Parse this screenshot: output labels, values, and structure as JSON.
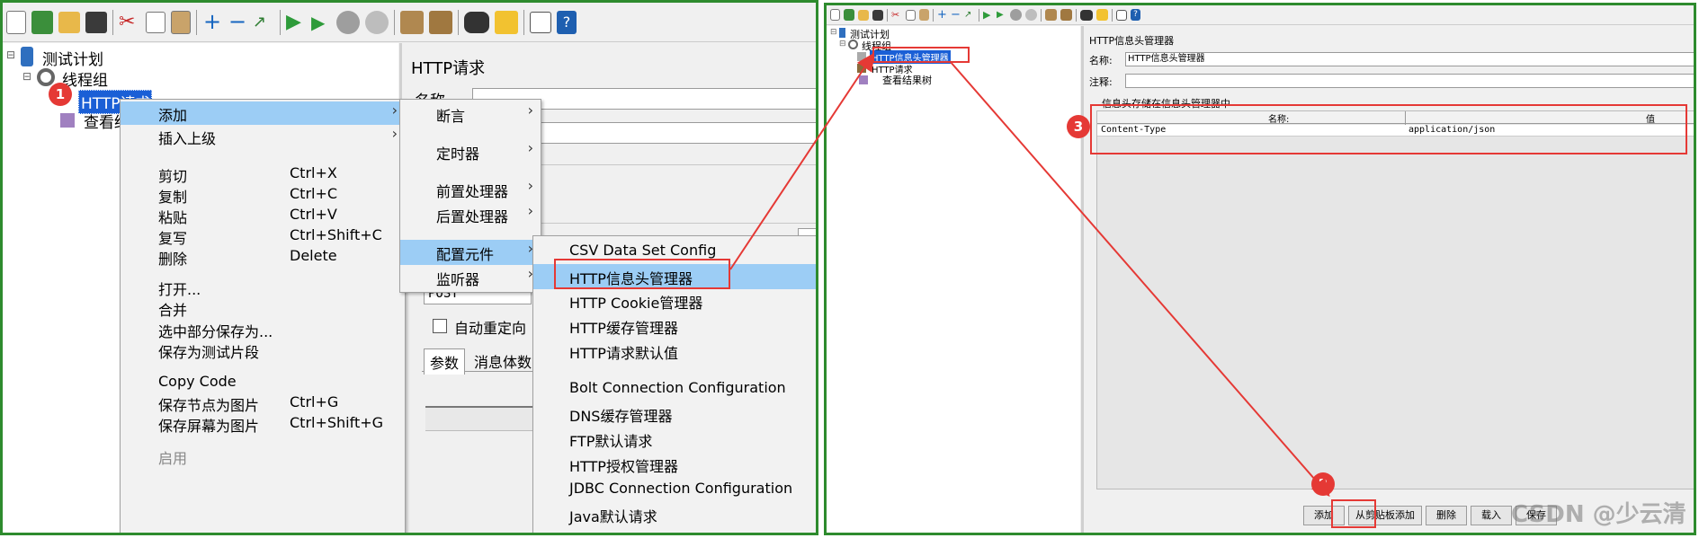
{
  "left": {
    "tree": {
      "test_plan": "测试计划",
      "thread_group": "线程组",
      "http_request": "HTTP请求",
      "view_results": "查看结"
    },
    "right_form": {
      "title": "HTTP请求",
      "name_label": "名称",
      "method_value": "POST",
      "auto_redirect": "自动重定向",
      "tab_params": "参数",
      "tab_body": "消息体数"
    },
    "context_menu": [
      {
        "label": "添加",
        "shortcut": "",
        "submenu": true
      },
      {
        "label": "插入上级",
        "shortcut": "",
        "submenu": true
      },
      {
        "label": "剪切",
        "shortcut": "Ctrl+X"
      },
      {
        "label": "复制",
        "shortcut": "Ctrl+C"
      },
      {
        "label": "粘贴",
        "shortcut": "Ctrl+V"
      },
      {
        "label": "复写",
        "shortcut": "Ctrl+Shift+C"
      },
      {
        "label": "删除",
        "shortcut": "Delete"
      },
      {
        "label": "打开...",
        "shortcut": ""
      },
      {
        "label": "合并",
        "shortcut": ""
      },
      {
        "label": "选中部分保存为...",
        "shortcut": ""
      },
      {
        "label": "保存为测试片段",
        "shortcut": ""
      },
      {
        "label": "Copy Code",
        "shortcut": ""
      },
      {
        "label": "保存节点为图片",
        "shortcut": "Ctrl+G"
      },
      {
        "label": "保存屏幕为图片",
        "shortcut": "Ctrl+Shift+G"
      },
      {
        "label": "启用",
        "shortcut": ""
      }
    ],
    "add_submenu": [
      "断言",
      "定时器",
      "前置处理器",
      "后置处理器",
      "配置元件",
      "监听器"
    ],
    "config_submenu": [
      "CSV Data Set Config",
      "HTTP信息头管理器",
      "HTTP Cookie管理器",
      "HTTP缓存管理器",
      "HTTP请求默认值",
      "Bolt Connection Configuration",
      "DNS缓存管理器",
      "FTP默认请求",
      "HTTP授权管理器",
      "JDBC Connection Configuration",
      "Java默认请求"
    ]
  },
  "right": {
    "tree": {
      "test_plan": "测试计划",
      "thread_group": "线程组",
      "header_manager": "HTTP信息头管理器",
      "http_request": "HTTP请求",
      "view_results": "查看结果树"
    },
    "form": {
      "title": "HTTP信息头管理器",
      "name_label": "名称:",
      "name_value": "HTTP信息头管理器",
      "comment_label": "注释:",
      "stored_label": "信息头存储在信息头管理器中",
      "col_name": "名称:",
      "col_value": "值",
      "row_name": "Content-Type",
      "row_value": "application/json"
    },
    "buttons": {
      "add": "添加",
      "paste": "从剪贴板添加",
      "delete": "删除",
      "load": "载入",
      "save": "保存"
    }
  },
  "badges": [
    "1",
    "2",
    "3"
  ],
  "watermark": "CSDN @少云清",
  "colors": {
    "border": "#2e8b2e",
    "annotation": "#e53935",
    "selection": "#1a5fd6",
    "highlight": "#9ccdf5"
  }
}
